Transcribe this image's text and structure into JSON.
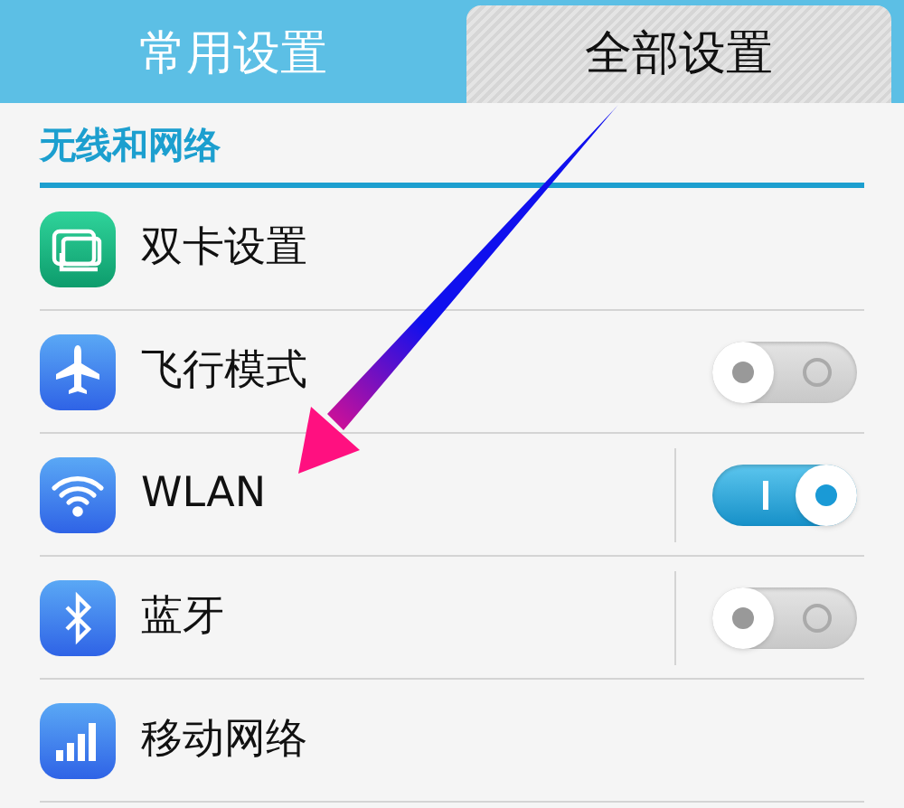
{
  "tabs": [
    {
      "label": "常用设置",
      "selected": false
    },
    {
      "label": "全部设置",
      "selected": true
    }
  ],
  "section": {
    "title": "无线和网络"
  },
  "rows": [
    {
      "label": "双卡设置",
      "kind": "link"
    },
    {
      "label": "飞行模式",
      "kind": "toggle",
      "on": false,
      "split": false
    },
    {
      "label": "WLAN",
      "kind": "toggle",
      "on": true,
      "split": true
    },
    {
      "label": "蓝牙",
      "kind": "toggle",
      "on": false,
      "split": true
    },
    {
      "label": "移动网络",
      "kind": "link"
    }
  ]
}
